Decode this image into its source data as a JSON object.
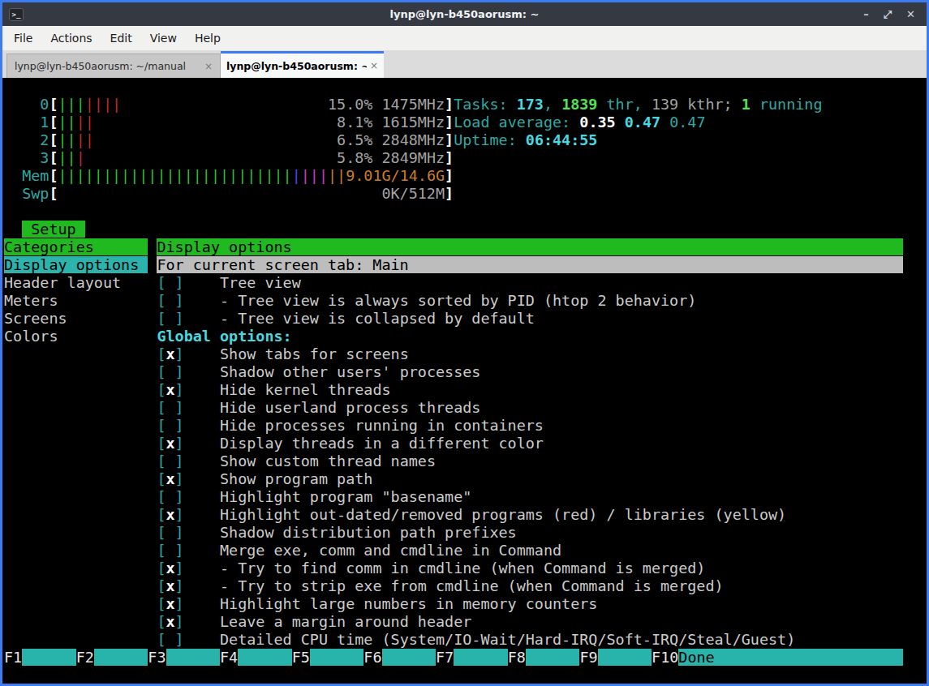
{
  "window": {
    "title": "lynp@lyn-b450aorusm: ~",
    "icon": "terminal",
    "controls": {
      "minimize": "–",
      "maximize": "⤢",
      "close": "✕"
    }
  },
  "menubar": {
    "items": [
      "File",
      "Actions",
      "Edit",
      "View",
      "Help"
    ]
  },
  "tabs": [
    {
      "label": "lynp@lyn-b450aorusm: ~/manual",
      "close": "×",
      "active": false
    },
    {
      "label": "lynp@lyn-b450aorusm: ~",
      "close": "×",
      "active": true
    }
  ],
  "colors": {
    "border": "#3d7cf0",
    "titlebar": "#353a42",
    "menubg": "#f1f1f0",
    "tabbarbg": "#dcdcdc",
    "cyan": "#2fa8a4",
    "bcyan": "#48d8e0",
    "bgreen": "#55e055",
    "gray": "#a3a3a3",
    "fgtext": "#cbcbcb",
    "orange": "#c87d2d",
    "bargreen": "#2ebe2e",
    "barred": "#c22a2a",
    "barblue": "#4b4be4",
    "barmagenta": "#c73bc7",
    "greenbg": "#20ba20",
    "cyanbg": "#2bb3ac",
    "silver": "#bdbdbd",
    "fbar": "#28b3ab"
  },
  "htop": {
    "meters": [
      {
        "label": "0",
        "bars": [
          [
            "green",
            3
          ],
          [
            "red",
            4
          ]
        ],
        "value": "15.0% 1475MHz",
        "valueClass": "gray"
      },
      {
        "label": "1",
        "bars": [
          [
            "green",
            2
          ],
          [
            "red",
            2
          ]
        ],
        "value": " 8.1% 1615MHz",
        "valueClass": "gray"
      },
      {
        "label": "2",
        "bars": [
          [
            "green",
            2
          ],
          [
            "red",
            2
          ]
        ],
        "value": " 6.5% 2848MHz",
        "valueClass": "gray"
      },
      {
        "label": "3",
        "bars": [
          [
            "green",
            2
          ],
          [
            "red",
            1
          ]
        ],
        "value": " 5.8% 2849MHz",
        "valueClass": "gray"
      },
      {
        "label": "Mem",
        "bars": [
          [
            "green",
            26
          ],
          [
            "blue",
            1
          ],
          [
            "magenta",
            3
          ],
          [
            "orange",
            2
          ]
        ],
        "value": "9.01G/14.6G",
        "valueClass": "orange"
      },
      {
        "label": "Swp",
        "bars": [],
        "value": "0K/512M",
        "valueClass": "gray"
      }
    ],
    "stats": {
      "tasks": [
        [
          "Tasks: ",
          "cyan"
        ],
        [
          "173",
          "bcyan"
        ],
        [
          ", ",
          "cyan"
        ],
        [
          "1839",
          "bgreen"
        ],
        [
          " thr, ",
          "cyan"
        ],
        [
          "139 kthr; ",
          "gray"
        ],
        [
          "1",
          "bgreen"
        ],
        [
          " running",
          "cyan"
        ]
      ],
      "load": [
        [
          "Load average: ",
          "cyan"
        ],
        [
          "0.35",
          "bwhite"
        ],
        [
          " ",
          "cyan"
        ],
        [
          "0.47",
          "bcyan"
        ],
        [
          " ",
          "cyan"
        ],
        [
          "0.47",
          "cyan"
        ]
      ],
      "uptime": [
        [
          "Uptime: ",
          "cyan"
        ],
        [
          "06:44:55",
          "bcyan"
        ]
      ]
    },
    "setup": {
      "tab": "Setup",
      "categories": [
        {
          "label": "Categories",
          "style": "header"
        },
        {
          "label": "Display options",
          "style": "selected"
        },
        {
          "label": "Header layout",
          "style": "normal"
        },
        {
          "label": "Meters",
          "style": "normal"
        },
        {
          "label": "Screens",
          "style": "normal"
        },
        {
          "label": "Colors",
          "style": "normal"
        }
      ],
      "panel": {
        "title": "Display options",
        "subtitle": "For current screen tab: Main",
        "items": [
          {
            "checked": false,
            "text": "Tree view"
          },
          {
            "checked": false,
            "text": "- Tree view is always sorted by PID (htop 2 behavior)"
          },
          {
            "checked": false,
            "text": "- Tree view is collapsed by default"
          },
          {
            "header": "Global options:"
          },
          {
            "checked": true,
            "text": "Show tabs for screens"
          },
          {
            "checked": false,
            "text": "Shadow other users' processes"
          },
          {
            "checked": true,
            "text": "Hide kernel threads"
          },
          {
            "checked": false,
            "text": "Hide userland process threads"
          },
          {
            "checked": false,
            "text": "Hide processes running in containers"
          },
          {
            "checked": true,
            "text": "Display threads in a different color"
          },
          {
            "checked": false,
            "text": "Show custom thread names"
          },
          {
            "checked": true,
            "text": "Show program path"
          },
          {
            "checked": false,
            "text": "Highlight program \"basename\""
          },
          {
            "checked": true,
            "text": "Highlight out-dated/removed programs (red) / libraries (yellow)"
          },
          {
            "checked": false,
            "text": "Shadow distribution path prefixes"
          },
          {
            "checked": false,
            "text": "Merge exe, comm and cmdline in Command"
          },
          {
            "checked": true,
            "text": "- Try to find comm in cmdline (when Command is merged)"
          },
          {
            "checked": true,
            "text": "- Try to strip exe from cmdline (when Command is merged)"
          },
          {
            "checked": true,
            "text": "Highlight large numbers in memory counters"
          },
          {
            "checked": true,
            "text": "Leave a margin around header"
          },
          {
            "checked": false,
            "text": "Detailed CPU time (System/IO-Wait/Hard-IRQ/Soft-IRQ/Steal/Guest)"
          }
        ]
      },
      "fkeys": [
        {
          "key": "F1",
          "label": ""
        },
        {
          "key": "F2",
          "label": ""
        },
        {
          "key": "F3",
          "label": ""
        },
        {
          "key": "F4",
          "label": ""
        },
        {
          "key": "F5",
          "label": ""
        },
        {
          "key": "F6",
          "label": ""
        },
        {
          "key": "F7",
          "label": ""
        },
        {
          "key": "F8",
          "label": ""
        },
        {
          "key": "F9",
          "label": ""
        },
        {
          "key": "F10",
          "label": "Done"
        }
      ]
    }
  }
}
